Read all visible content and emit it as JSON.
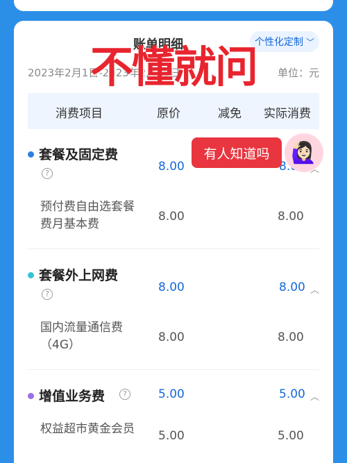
{
  "header": {
    "bill_title": "账单明细",
    "custom_button": "个性化定制",
    "date_range": "2023年2月1日-2023年2月28日",
    "unit": "单位：元"
  },
  "table": {
    "columns": [
      "消费项目",
      "原价",
      "减免",
      "实际消费"
    ]
  },
  "sections": [
    {
      "title": "套餐及固定费",
      "dot_color": "#2e7fe0",
      "original": "8.00",
      "actual": "8.00",
      "items": [
        {
          "name": "预付费自由选套餐费月基本费",
          "original": "8.00",
          "actual": "8.00"
        }
      ]
    },
    {
      "title": "套餐外上网费",
      "dot_color": "#35c3d6",
      "original": "8.00",
      "actual": "8.00",
      "items": [
        {
          "name": "国内流量通信费（4G）",
          "original": "8.00",
          "actual": "8.00"
        }
      ]
    },
    {
      "title": "增值业务费",
      "dot_color": "#9b6ee8",
      "original": "5.00",
      "actual": "5.00",
      "items": [
        {
          "name": "权益超市黄金会员",
          "original": "5.00",
          "actual": "5.00"
        }
      ]
    }
  ],
  "overlay": {
    "headline": "不懂就问",
    "pill": "有人知道吗",
    "emoji": "🙋🏻‍♀️"
  },
  "colors": {
    "accent": "#1769d8",
    "background": "#2b8fe8",
    "overlay_red": "#e8252f"
  }
}
